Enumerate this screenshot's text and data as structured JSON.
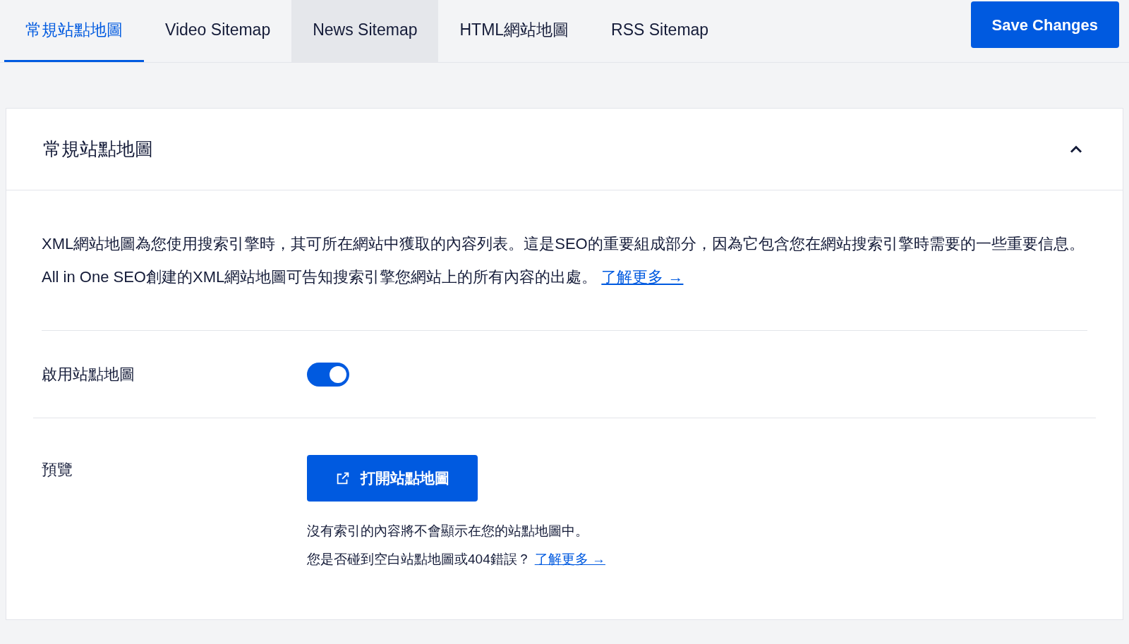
{
  "tabs": [
    {
      "label": "常規站點地圖",
      "selected": true,
      "hovered": false
    },
    {
      "label": "Video Sitemap",
      "selected": false,
      "hovered": false
    },
    {
      "label": "News Sitemap",
      "selected": false,
      "hovered": true
    },
    {
      "label": "HTML網站地圖",
      "selected": false,
      "hovered": false
    },
    {
      "label": "RSS Sitemap",
      "selected": false,
      "hovered": false
    }
  ],
  "save_button": "Save Changes",
  "card": {
    "title": "常規站點地圖",
    "expanded": true,
    "description": "XML網站地圖為您使用搜索引擎時，其可所在網站中獲取的內容列表。這是SEO的重要組成部分，因為它包含您在網站搜索引擎時需要的一些重要信息。 All in One SEO創建的XML網站地圖可告知搜索引擎您網站上的所有內容的出處。",
    "description_link": "了解更多 →",
    "enable": {
      "label": "啟用站點地圖",
      "on": true
    },
    "preview": {
      "label": "預覽",
      "button": "打開站點地圖",
      "note": "沒有索引的內容將不會顯示在您的站點地圖中。",
      "note2": "您是否碰到空白站點地圖或404錯誤？",
      "note_link": "了解更多 →"
    }
  }
}
